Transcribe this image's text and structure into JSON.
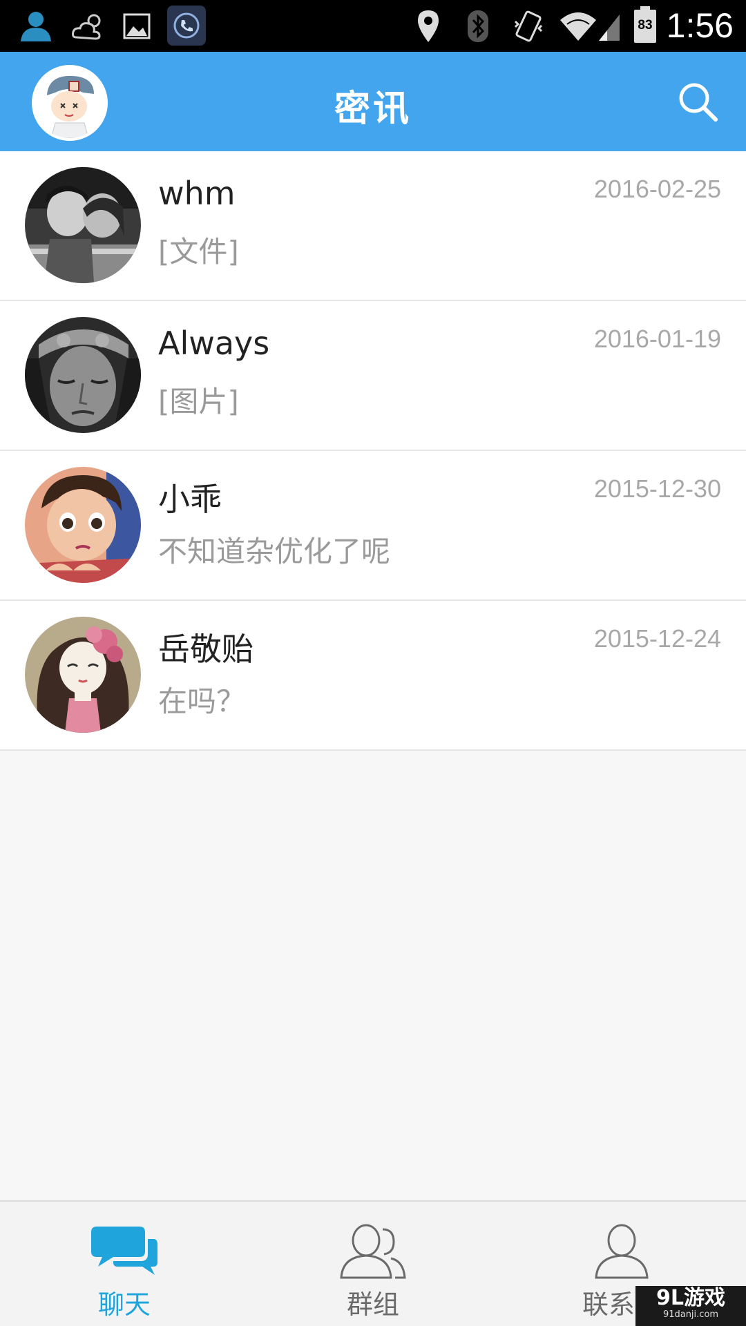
{
  "status_bar": {
    "time": "1:56",
    "battery": "83",
    "icons": [
      "person-icon",
      "weather-icon",
      "image-icon",
      "phone-icon",
      "location-icon",
      "bluetooth-icon",
      "vibrate-icon",
      "wifi-icon",
      "signal-icon",
      "battery-icon"
    ]
  },
  "header": {
    "title": "密讯",
    "icons": [
      "avatar",
      "search-icon"
    ]
  },
  "chats": [
    {
      "name": "whm",
      "preview": "[文件]",
      "date": "2016-02-25"
    },
    {
      "name": "Always",
      "preview": "[图片]",
      "date": "2016-01-19"
    },
    {
      "name": "小乖",
      "preview": "不知道杂优化了呢",
      "date": "2015-12-30"
    },
    {
      "name": "岳敬贻",
      "preview": "在吗？",
      "date": "2015-12-24"
    }
  ],
  "bottom_nav": [
    {
      "label": "聊天",
      "icon": "chat-icon",
      "active": true
    },
    {
      "label": "群组",
      "icon": "group-icon",
      "active": false
    },
    {
      "label": "联系人",
      "icon": "contact-icon",
      "active": false
    }
  ],
  "watermark": {
    "main": "9L游戏",
    "sub": "91danji.com"
  },
  "colors": {
    "header_bg": "#42a5ee",
    "active_tab": "#1fa4dc",
    "date_text": "#a8a8a8",
    "preview_text": "#9a9a9a"
  }
}
